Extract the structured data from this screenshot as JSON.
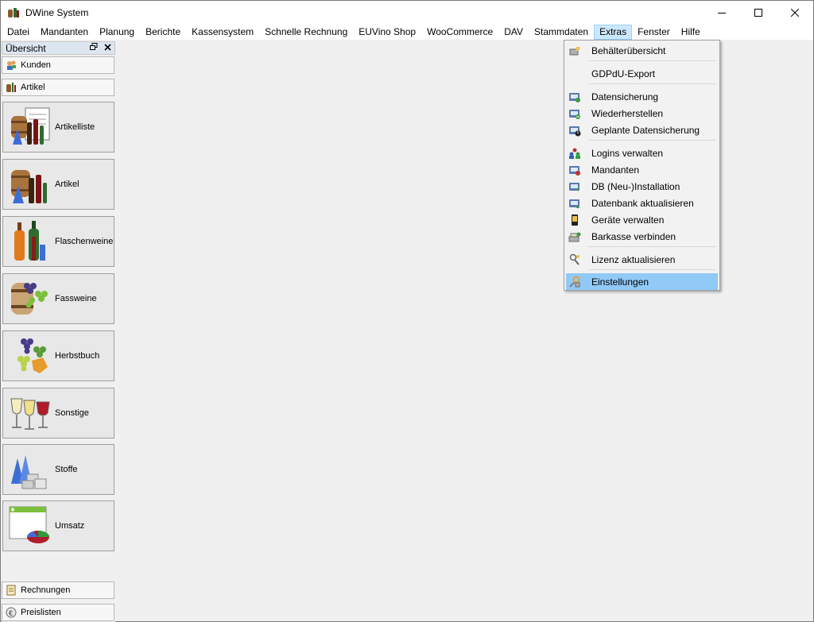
{
  "window": {
    "title": "DWine System"
  },
  "menubar": {
    "items": [
      "Datei",
      "Mandanten",
      "Planung",
      "Berichte",
      "Kassensystem",
      "Schnelle Rechnung",
      "EUVino Shop",
      "WooCommerce",
      "DAV",
      "Stammdaten",
      "Extras",
      "Fenster",
      "Hilfe"
    ],
    "active": "Extras"
  },
  "sidebar": {
    "title": "Übersicht",
    "top_tabs": [
      "Kunden",
      "Artikel"
    ],
    "tiles": [
      "Artikelliste",
      "Artikel",
      "Flaschenweine",
      "Fassweine",
      "Herbstbuch",
      "Sonstige",
      "Stoffe",
      "Umsatz"
    ],
    "bottom_tabs": [
      "Rechnungen",
      "Preislisten"
    ]
  },
  "extras_menu": {
    "items": [
      "Behälterübersicht",
      "GDPdU-Export",
      "Datensicherung",
      "Wiederherstellen",
      "Geplante Datensicherung",
      "Logins verwalten",
      "Mandanten",
      "DB (Neu-)Installation",
      "Datenbank aktualisieren",
      "Geräte verwalten",
      "Barkasse verbinden",
      "Lizenz aktualisieren",
      "Einstellungen"
    ],
    "highlighted": "Einstellungen"
  },
  "colors": {
    "menu_highlight": "#91c9f7",
    "menubar_active": "#cce8ff"
  }
}
